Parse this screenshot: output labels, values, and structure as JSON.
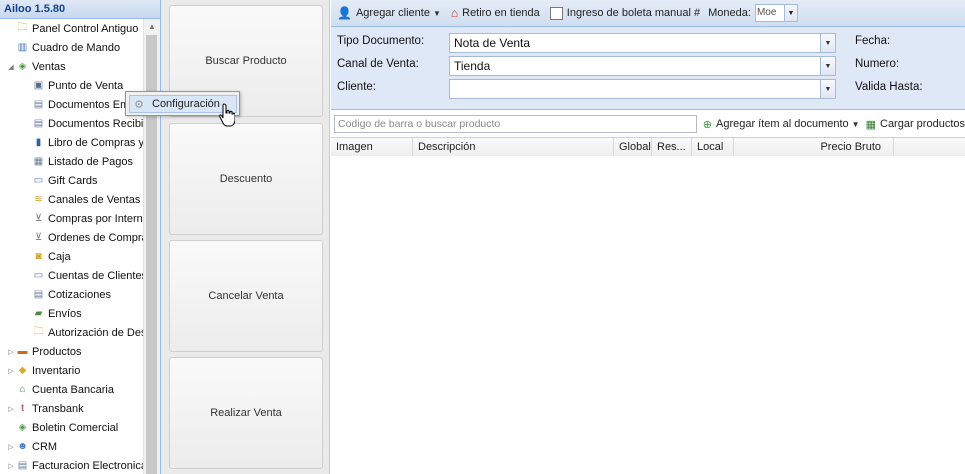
{
  "app": {
    "title": "Ailoo 1.5.80"
  },
  "tree": {
    "items": [
      {
        "label": "Panel Control Antiguo",
        "icon": "folder-icon"
      },
      {
        "label": "Cuadro de Mando",
        "icon": "bar-chart-icon"
      },
      {
        "label": "Ventas",
        "icon": "tag-icon",
        "expanded": true
      },
      {
        "label": "Punto de Venta",
        "icon": "pos-terminal-icon"
      },
      {
        "label": "Documentos Em",
        "icon": "document-icon"
      },
      {
        "label": "Documentos Recibi",
        "icon": "document-icon"
      },
      {
        "label": "Libro de Compras y",
        "icon": "book-icon"
      },
      {
        "label": "Listado de Pagos",
        "icon": "calculator-icon"
      },
      {
        "label": "Gift Cards",
        "icon": "gift-card-icon"
      },
      {
        "label": "Canales de Ventas",
        "icon": "channels-icon"
      },
      {
        "label": "Compras por Interne",
        "icon": "shopping-cart-icon"
      },
      {
        "label": "Ordenes de Compra",
        "icon": "shopping-cart-icon"
      },
      {
        "label": "Caja",
        "icon": "cash-icon"
      },
      {
        "label": "Cuentas de Clientes",
        "icon": "card-icon"
      },
      {
        "label": "Cotizaciones",
        "icon": "document-icon"
      },
      {
        "label": "Envíos",
        "icon": "truck-icon"
      },
      {
        "label": "Autorización de Des",
        "icon": "folder-icon"
      },
      {
        "label": "Productos",
        "icon": "box-icon"
      },
      {
        "label": "Inventario",
        "icon": "package-icon"
      },
      {
        "label": "Cuenta Bancaria",
        "icon": "bank-icon"
      },
      {
        "label": "Transbank",
        "icon": "transbank-icon"
      },
      {
        "label": "Boletin Comercial",
        "icon": "tag-icon"
      },
      {
        "label": "CRM",
        "icon": "users-icon"
      },
      {
        "label": "Facturacion Electronica",
        "icon": "document-icon"
      }
    ]
  },
  "context_menu": {
    "item_label": "Configuración"
  },
  "actions": {
    "buscar": "Buscar Producto",
    "descuento": "Descuento",
    "cancelar": "Cancelar Venta",
    "realizar": "Realizar Venta"
  },
  "toolbar": {
    "agregar_cliente": "Agregar cliente",
    "retiro": "Retiro en tienda",
    "ingreso_boleta": "Ingreso de boleta manual #",
    "moneda_label": "Moneda:",
    "moneda_value": "Moe"
  },
  "form": {
    "tipo_label": "Tipo Documento:",
    "tipo_value": "Nota de Venta",
    "canal_label": "Canal de Venta:",
    "canal_value": "Tienda",
    "cliente_label": "Cliente:",
    "cliente_value": "",
    "fecha_label": "Fecha:",
    "numero_label": "Numero:",
    "valida_label": "Valida Hasta:"
  },
  "search": {
    "placeholder": "Codigo de barra o buscar producto",
    "agregar_item": "Agregar ítem al documento",
    "cargar": "Cargar productos"
  },
  "grid": {
    "columns": [
      "Imagen",
      "Descripción",
      "Global",
      "Res...",
      "Local",
      "Precio Bruto"
    ]
  },
  "colors": {
    "accent_blue": "#99bbe8",
    "form_bg": "#dfe8f6",
    "header_text": "#15428b"
  }
}
